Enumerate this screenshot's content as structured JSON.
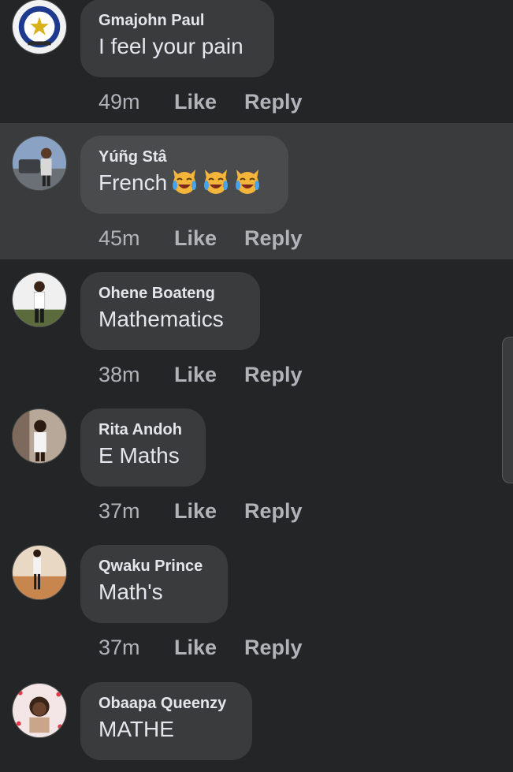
{
  "comments": [
    {
      "author": "Gmajohn Paul",
      "text": "I feel your pain",
      "time": "49m",
      "like": "Like",
      "reply": "Reply",
      "avatar": "police-badge-avatar",
      "highlighted": false
    },
    {
      "author": "Yúñg Stâ",
      "text": "French",
      "time": "45m",
      "like": "Like",
      "reply": "Reply",
      "avatar": "person-avatar",
      "highlighted": true,
      "emoji": [
        "crying-laughing-cat-emoji",
        "crying-laughing-cat-emoji",
        "crying-laughing-cat-emoji"
      ]
    },
    {
      "author": "Ohene Boateng",
      "text": "Mathematics",
      "time": "38m",
      "like": "Like",
      "reply": "Reply",
      "avatar": "person-avatar",
      "highlighted": false
    },
    {
      "author": "Rita Andoh",
      "text": "E Maths",
      "time": "37m",
      "like": "Like",
      "reply": "Reply",
      "avatar": "person-avatar",
      "highlighted": false
    },
    {
      "author": "Qwaku Prince",
      "text": "Math's",
      "time": "37m",
      "like": "Like",
      "reply": "Reply",
      "avatar": "person-avatar",
      "highlighted": false
    },
    {
      "author": "Obaapa Queenzy",
      "text": "MATHE",
      "time": "",
      "like": "",
      "reply": "",
      "avatar": "person-avatar",
      "highlighted": false
    }
  ],
  "colors": {
    "background": "#242526",
    "highlight": "#3a3b3c",
    "bubble": "#3a3b3c",
    "text": "#e4e6eb",
    "meta": "#b0b3b8"
  }
}
